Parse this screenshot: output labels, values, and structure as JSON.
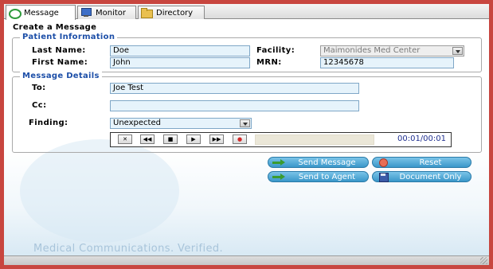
{
  "tabs": [
    {
      "label": "Message",
      "icon": "message-icon",
      "active": true
    },
    {
      "label": "Monitor",
      "icon": "monitor-icon",
      "active": false
    },
    {
      "label": "Directory",
      "icon": "folder-icon",
      "active": false
    }
  ],
  "create_title": "Create a Message",
  "patient": {
    "legend": "Patient Information",
    "last_name_label": "Last Name:",
    "last_name": "Doe",
    "first_name_label": "First Name:",
    "first_name": "John",
    "facility_label": "Facility:",
    "facility": "Maimonides Med Center",
    "mrn_label": "MRN:",
    "mrn": "12345678"
  },
  "details": {
    "legend": "Message Details",
    "to_label": "To:",
    "to": "Joe Test",
    "cc_label": "Cc:",
    "cc": "",
    "finding_label": "Finding:",
    "finding": "Unexpected"
  },
  "player": {
    "stop": "✕",
    "rewind": "◀◀",
    "pause": "■",
    "play": "▶",
    "forward": "▶▶",
    "record": "●",
    "time": "00:01/00:01",
    "progress": 0
  },
  "actions": {
    "send_message": "Send Message",
    "reset": "Reset",
    "send_to_agent": "Send to Agent",
    "document_only": "Document Only"
  },
  "tagline": "Medical Communications. Verified.",
  "colors": {
    "frame_border": "#c8463f",
    "legend": "#1d4fa8",
    "field_bg": "#e6f3fb",
    "button": "#3a97c9"
  }
}
